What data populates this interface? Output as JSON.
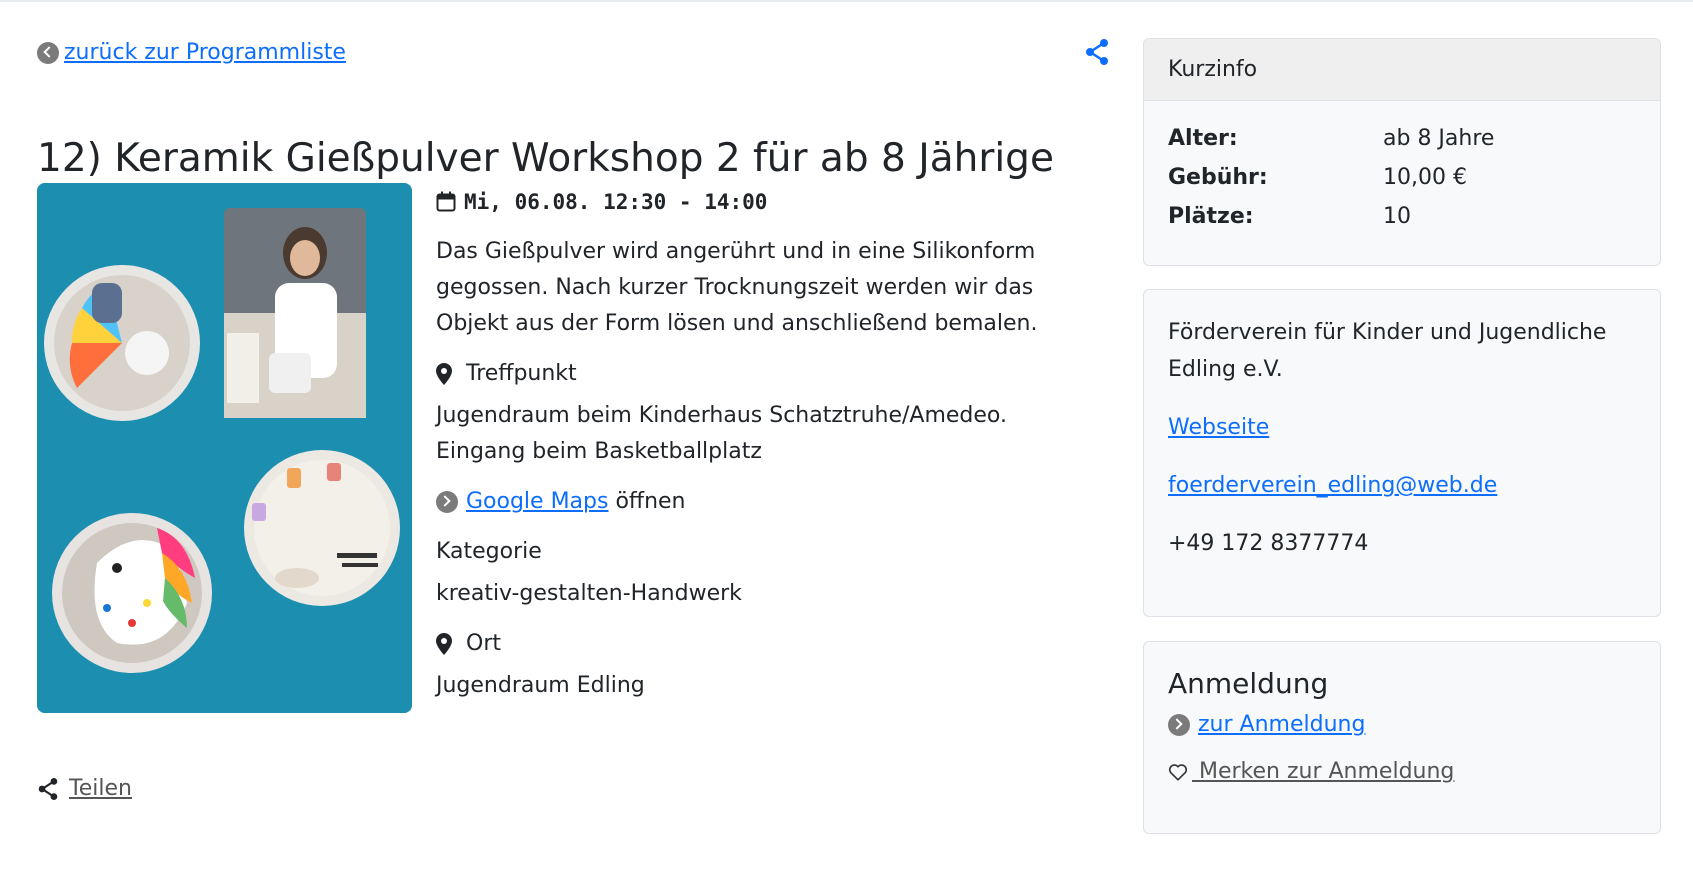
{
  "nav": {
    "back_label": "zurück zur Programmliste"
  },
  "event": {
    "title": "12) Keramik Gießpulver Workshop 2 für ab 8 Jährige",
    "date": "Mi, 06.08. 12:30 - 14:00",
    "description": "Das Gießpulver wird angerührt und in eine Silikonform gegossen. Nach kurzer Trocknungszeit werden wir das Objekt aus der Form lösen und anschließend bemalen.",
    "meeting_point_label": "Treffpunkt",
    "meeting_point_line1": "Jugendraum beim Kinderhaus Schatztruhe/Amedeo.",
    "meeting_point_line2": "Eingang beim Basketballplatz",
    "maps_link": "Google Maps",
    "maps_suffix": " öffnen",
    "category_label": "Kategorie",
    "category_value": "kreativ-gestalten-Handwerk",
    "location_label": "Ort",
    "location_value": "Jugendraum Edling",
    "share_label": "Teilen"
  },
  "kurzinfo": {
    "header": "Kurzinfo",
    "rows": [
      {
        "key": "Alter:",
        "value": "ab 8 Jahre"
      },
      {
        "key": "Gebühr:",
        "value": "10,00 €"
      },
      {
        "key": "Plätze:",
        "value": "10"
      }
    ]
  },
  "organizer": {
    "name": "Förderverein für Kinder und Jugendliche Edling e.V.",
    "website_label": "Webseite",
    "email": "foerderverein_edling@web.de",
    "phone": "+49 172 8377774"
  },
  "registration": {
    "heading": "Anmeldung",
    "register_label": "zur Anmeldung",
    "remember_label": " Merken zur Anmeldung"
  },
  "colors": {
    "link": "#0d6efd",
    "image_background": "#1c8fb0",
    "card_background": "#f8f9fa",
    "card_border": "#dee2e6"
  },
  "icons": [
    "chevron-left-circle-icon",
    "share-icon",
    "calendar-icon",
    "map-pin-icon",
    "chevron-right-circle-icon",
    "heart-icon"
  ]
}
